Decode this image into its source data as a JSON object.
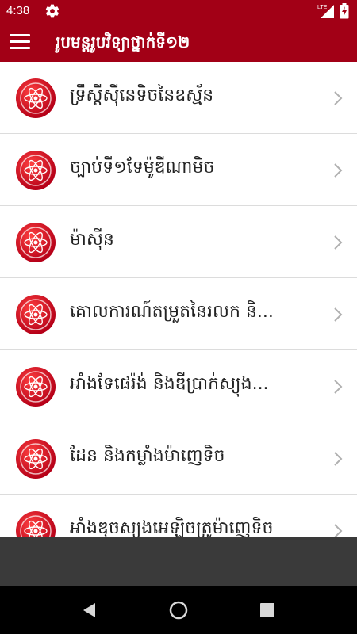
{
  "status_bar": {
    "time": "4:38",
    "network": "LTE",
    "icons": [
      "gear-icon",
      "signal-icon",
      "battery-charging-icon"
    ]
  },
  "app_bar": {
    "title": "រូបមន្តរូបវិទ្យាថ្នាក់ទី១២",
    "menu_icon": "hamburger-menu-icon"
  },
  "colors": {
    "primary": "#a20016",
    "icon_red": "#c8102e",
    "divider": "#dcdcdc",
    "banner": "#3a3a3a",
    "nav_bar": "#000000"
  },
  "list": {
    "items": [
      {
        "label": "ទ្រឹស្តីស៊ីនេទិចនៃឧស្ម័ន",
        "icon": "atom-icon"
      },
      {
        "label": "ច្បាប់ទី១ទែម៉ូឌីណាមិច",
        "icon": "atom-icon"
      },
      {
        "label": "ម៉ាស៊ីន",
        "icon": "atom-icon"
      },
      {
        "label": "គោលការណ៍តម្រួតនៃរលក និ...",
        "icon": "atom-icon"
      },
      {
        "label": "អាំងទែផេរ៉ង់ និងឌីប្រាក់ស្យុង...",
        "icon": "atom-icon"
      },
      {
        "label": "ដែន និងកម្លាំងម៉ាញេទិច",
        "icon": "atom-icon"
      },
      {
        "label": "អាំងឌុចស្យុងអេឡិចត្រូម៉ាញេទិច",
        "icon": "atom-icon"
      }
    ]
  },
  "nav": {
    "back_icon": "back-triangle-icon",
    "home_icon": "home-circle-icon",
    "recents_icon": "recents-square-icon"
  }
}
